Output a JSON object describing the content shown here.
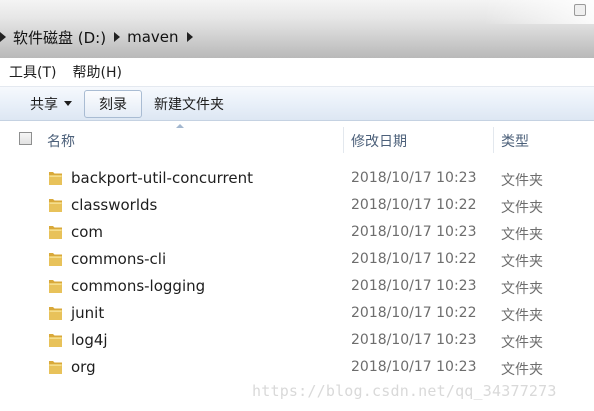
{
  "breadcrumb": {
    "items": [
      "软件磁盘 (D:)",
      "maven"
    ]
  },
  "menu": {
    "items": [
      "工具(T)",
      "帮助(H)"
    ]
  },
  "toolbar": {
    "share_label": "共享",
    "burn_label": "刻录",
    "new_folder_label": "新建文件夹"
  },
  "columns": {
    "name": "名称",
    "modified": "修改日期",
    "type": "类型"
  },
  "files": [
    {
      "name": "backport-util-concurrent",
      "modified": "2018/10/17 10:23",
      "type": "文件夹"
    },
    {
      "name": "classworlds",
      "modified": "2018/10/17 10:22",
      "type": "文件夹"
    },
    {
      "name": "com",
      "modified": "2018/10/17 10:23",
      "type": "文件夹"
    },
    {
      "name": "commons-cli",
      "modified": "2018/10/17 10:22",
      "type": "文件夹"
    },
    {
      "name": "commons-logging",
      "modified": "2018/10/17 10:23",
      "type": "文件夹"
    },
    {
      "name": "junit",
      "modified": "2018/10/17 10:22",
      "type": "文件夹"
    },
    {
      "name": "log4j",
      "modified": "2018/10/17 10:23",
      "type": "文件夹"
    },
    {
      "name": "org",
      "modified": "2018/10/17 10:23",
      "type": "文件夹"
    }
  ],
  "watermark": "https://blog.csdn.net/qq_34377273",
  "icons": {
    "folder": "folder-icon",
    "breadcrumb_separator": "chevron-right-icon",
    "share_dropdown": "caret-down-icon",
    "sort_indicator": "sort-up-icon"
  },
  "colors": {
    "folder": "#e8c25a",
    "header_text": "#4c607a",
    "toolbar_bg": "#e9f0f9",
    "meta_text": "#6d6d6d"
  }
}
